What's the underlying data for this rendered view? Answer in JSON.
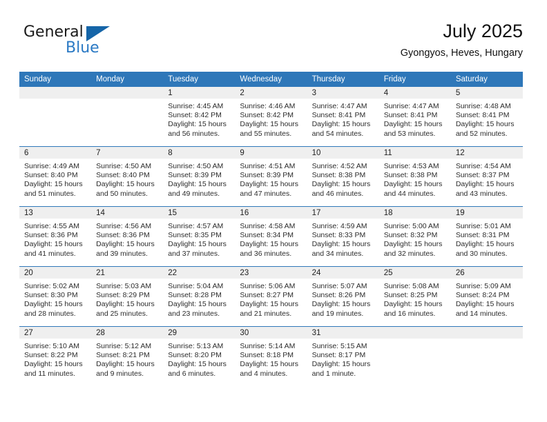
{
  "brand": {
    "name_part1": "General",
    "name_part2": "Blue",
    "triangle_color": "#1565a8",
    "blue_color": "#2a79c4"
  },
  "header": {
    "month_title": "July 2025",
    "location": "Gyongyos, Heves, Hungary"
  },
  "theme": {
    "header_bg": "#2e77b9",
    "daynum_bg": "#efefef",
    "row_separator": "#2e77b9"
  },
  "calendar": {
    "weekday_headers": [
      "Sunday",
      "Monday",
      "Tuesday",
      "Wednesday",
      "Thursday",
      "Friday",
      "Saturday"
    ],
    "weeks": [
      [
        {
          "day": "",
          "sunrise": "",
          "sunset": "",
          "daylight_line1": "",
          "daylight_line2": ""
        },
        {
          "day": "",
          "sunrise": "",
          "sunset": "",
          "daylight_line1": "",
          "daylight_line2": ""
        },
        {
          "day": "1",
          "sunrise": "Sunrise: 4:45 AM",
          "sunset": "Sunset: 8:42 PM",
          "daylight_line1": "Daylight: 15 hours",
          "daylight_line2": "and 56 minutes."
        },
        {
          "day": "2",
          "sunrise": "Sunrise: 4:46 AM",
          "sunset": "Sunset: 8:42 PM",
          "daylight_line1": "Daylight: 15 hours",
          "daylight_line2": "and 55 minutes."
        },
        {
          "day": "3",
          "sunrise": "Sunrise: 4:47 AM",
          "sunset": "Sunset: 8:41 PM",
          "daylight_line1": "Daylight: 15 hours",
          "daylight_line2": "and 54 minutes."
        },
        {
          "day": "4",
          "sunrise": "Sunrise: 4:47 AM",
          "sunset": "Sunset: 8:41 PM",
          "daylight_line1": "Daylight: 15 hours",
          "daylight_line2": "and 53 minutes."
        },
        {
          "day": "5",
          "sunrise": "Sunrise: 4:48 AM",
          "sunset": "Sunset: 8:41 PM",
          "daylight_line1": "Daylight: 15 hours",
          "daylight_line2": "and 52 minutes."
        }
      ],
      [
        {
          "day": "6",
          "sunrise": "Sunrise: 4:49 AM",
          "sunset": "Sunset: 8:40 PM",
          "daylight_line1": "Daylight: 15 hours",
          "daylight_line2": "and 51 minutes."
        },
        {
          "day": "7",
          "sunrise": "Sunrise: 4:50 AM",
          "sunset": "Sunset: 8:40 PM",
          "daylight_line1": "Daylight: 15 hours",
          "daylight_line2": "and 50 minutes."
        },
        {
          "day": "8",
          "sunrise": "Sunrise: 4:50 AM",
          "sunset": "Sunset: 8:39 PM",
          "daylight_line1": "Daylight: 15 hours",
          "daylight_line2": "and 49 minutes."
        },
        {
          "day": "9",
          "sunrise": "Sunrise: 4:51 AM",
          "sunset": "Sunset: 8:39 PM",
          "daylight_line1": "Daylight: 15 hours",
          "daylight_line2": "and 47 minutes."
        },
        {
          "day": "10",
          "sunrise": "Sunrise: 4:52 AM",
          "sunset": "Sunset: 8:38 PM",
          "daylight_line1": "Daylight: 15 hours",
          "daylight_line2": "and 46 minutes."
        },
        {
          "day": "11",
          "sunrise": "Sunrise: 4:53 AM",
          "sunset": "Sunset: 8:38 PM",
          "daylight_line1": "Daylight: 15 hours",
          "daylight_line2": "and 44 minutes."
        },
        {
          "day": "12",
          "sunrise": "Sunrise: 4:54 AM",
          "sunset": "Sunset: 8:37 PM",
          "daylight_line1": "Daylight: 15 hours",
          "daylight_line2": "and 43 minutes."
        }
      ],
      [
        {
          "day": "13",
          "sunrise": "Sunrise: 4:55 AM",
          "sunset": "Sunset: 8:36 PM",
          "daylight_line1": "Daylight: 15 hours",
          "daylight_line2": "and 41 minutes."
        },
        {
          "day": "14",
          "sunrise": "Sunrise: 4:56 AM",
          "sunset": "Sunset: 8:36 PM",
          "daylight_line1": "Daylight: 15 hours",
          "daylight_line2": "and 39 minutes."
        },
        {
          "day": "15",
          "sunrise": "Sunrise: 4:57 AM",
          "sunset": "Sunset: 8:35 PM",
          "daylight_line1": "Daylight: 15 hours",
          "daylight_line2": "and 37 minutes."
        },
        {
          "day": "16",
          "sunrise": "Sunrise: 4:58 AM",
          "sunset": "Sunset: 8:34 PM",
          "daylight_line1": "Daylight: 15 hours",
          "daylight_line2": "and 36 minutes."
        },
        {
          "day": "17",
          "sunrise": "Sunrise: 4:59 AM",
          "sunset": "Sunset: 8:33 PM",
          "daylight_line1": "Daylight: 15 hours",
          "daylight_line2": "and 34 minutes."
        },
        {
          "day": "18",
          "sunrise": "Sunrise: 5:00 AM",
          "sunset": "Sunset: 8:32 PM",
          "daylight_line1": "Daylight: 15 hours",
          "daylight_line2": "and 32 minutes."
        },
        {
          "day": "19",
          "sunrise": "Sunrise: 5:01 AM",
          "sunset": "Sunset: 8:31 PM",
          "daylight_line1": "Daylight: 15 hours",
          "daylight_line2": "and 30 minutes."
        }
      ],
      [
        {
          "day": "20",
          "sunrise": "Sunrise: 5:02 AM",
          "sunset": "Sunset: 8:30 PM",
          "daylight_line1": "Daylight: 15 hours",
          "daylight_line2": "and 28 minutes."
        },
        {
          "day": "21",
          "sunrise": "Sunrise: 5:03 AM",
          "sunset": "Sunset: 8:29 PM",
          "daylight_line1": "Daylight: 15 hours",
          "daylight_line2": "and 25 minutes."
        },
        {
          "day": "22",
          "sunrise": "Sunrise: 5:04 AM",
          "sunset": "Sunset: 8:28 PM",
          "daylight_line1": "Daylight: 15 hours",
          "daylight_line2": "and 23 minutes."
        },
        {
          "day": "23",
          "sunrise": "Sunrise: 5:06 AM",
          "sunset": "Sunset: 8:27 PM",
          "daylight_line1": "Daylight: 15 hours",
          "daylight_line2": "and 21 minutes."
        },
        {
          "day": "24",
          "sunrise": "Sunrise: 5:07 AM",
          "sunset": "Sunset: 8:26 PM",
          "daylight_line1": "Daylight: 15 hours",
          "daylight_line2": "and 19 minutes."
        },
        {
          "day": "25",
          "sunrise": "Sunrise: 5:08 AM",
          "sunset": "Sunset: 8:25 PM",
          "daylight_line1": "Daylight: 15 hours",
          "daylight_line2": "and 16 minutes."
        },
        {
          "day": "26",
          "sunrise": "Sunrise: 5:09 AM",
          "sunset": "Sunset: 8:24 PM",
          "daylight_line1": "Daylight: 15 hours",
          "daylight_line2": "and 14 minutes."
        }
      ],
      [
        {
          "day": "27",
          "sunrise": "Sunrise: 5:10 AM",
          "sunset": "Sunset: 8:22 PM",
          "daylight_line1": "Daylight: 15 hours",
          "daylight_line2": "and 11 minutes."
        },
        {
          "day": "28",
          "sunrise": "Sunrise: 5:12 AM",
          "sunset": "Sunset: 8:21 PM",
          "daylight_line1": "Daylight: 15 hours",
          "daylight_line2": "and 9 minutes."
        },
        {
          "day": "29",
          "sunrise": "Sunrise: 5:13 AM",
          "sunset": "Sunset: 8:20 PM",
          "daylight_line1": "Daylight: 15 hours",
          "daylight_line2": "and 6 minutes."
        },
        {
          "day": "30",
          "sunrise": "Sunrise: 5:14 AM",
          "sunset": "Sunset: 8:18 PM",
          "daylight_line1": "Daylight: 15 hours",
          "daylight_line2": "and 4 minutes."
        },
        {
          "day": "31",
          "sunrise": "Sunrise: 5:15 AM",
          "sunset": "Sunset: 8:17 PM",
          "daylight_line1": "Daylight: 15 hours",
          "daylight_line2": "and 1 minute."
        },
        {
          "day": "",
          "sunrise": "",
          "sunset": "",
          "daylight_line1": "",
          "daylight_line2": ""
        },
        {
          "day": "",
          "sunrise": "",
          "sunset": "",
          "daylight_line1": "",
          "daylight_line2": ""
        }
      ]
    ]
  }
}
